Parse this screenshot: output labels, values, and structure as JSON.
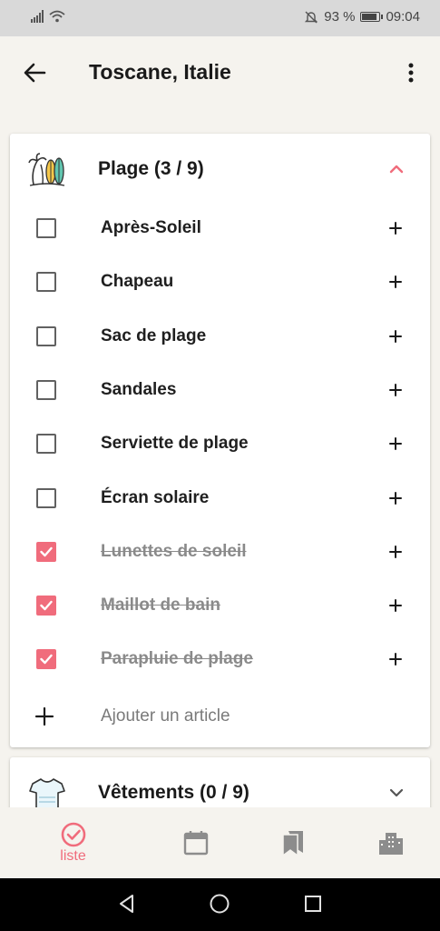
{
  "status": {
    "battery": "93 %",
    "time": "09:04",
    "battery_level": 0.93
  },
  "appbar": {
    "title": "Toscane, Italie"
  },
  "categories": [
    {
      "title": "Plage (3 / 9)",
      "expanded": true,
      "icon": "beach-palm-surfboard-icon",
      "items": [
        {
          "label": "Après-Soleil",
          "checked": false
        },
        {
          "label": "Chapeau",
          "checked": false
        },
        {
          "label": "Sac de plage",
          "checked": false
        },
        {
          "label": "Sandales",
          "checked": false
        },
        {
          "label": "Serviette de plage",
          "checked": false
        },
        {
          "label": "Écran solaire",
          "checked": false
        },
        {
          "label": "Lunettes de soleil",
          "checked": true
        },
        {
          "label": "Maillot de bain",
          "checked": true
        },
        {
          "label": "Parapluie de plage",
          "checked": true
        }
      ],
      "add_label": "Ajouter un article"
    },
    {
      "title": "Vêtements (0 / 9)",
      "expanded": false,
      "icon": "tshirt-icon"
    }
  ],
  "bottom_nav": [
    {
      "label": "liste",
      "icon": "check-circle-icon",
      "active": true
    },
    {
      "label": "",
      "icon": "calendar-icon",
      "active": false
    },
    {
      "label": "",
      "icon": "bookmarks-icon",
      "active": false
    },
    {
      "label": "",
      "icon": "city-icon",
      "active": false
    }
  ],
  "colors": {
    "accent": "#f06c7c",
    "background": "#f5f3ee",
    "card": "#ffffff"
  }
}
